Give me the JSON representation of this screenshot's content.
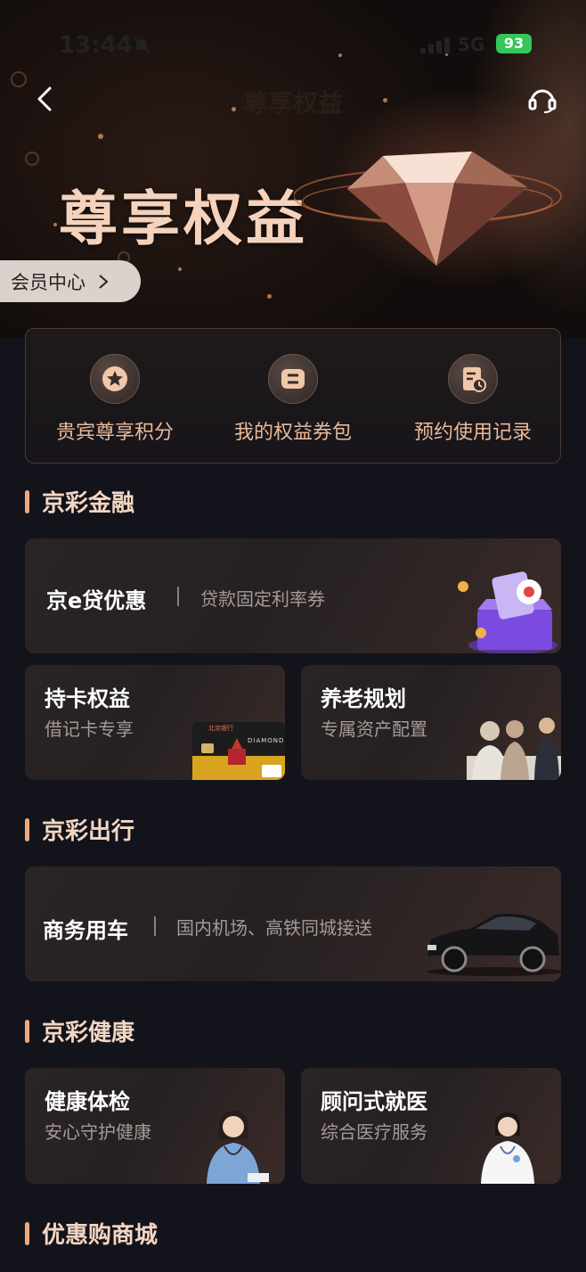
{
  "status": {
    "time": "13:44",
    "network": "5G",
    "battery": "93"
  },
  "nav": {
    "title": "尊享权益"
  },
  "hero": {
    "title": "尊享权益",
    "member_center": "会员中心"
  },
  "quick": [
    {
      "label": "贵宾尊享积分",
      "icon": "star-badge-icon"
    },
    {
      "label": "我的权益券包",
      "icon": "coupon-icon"
    },
    {
      "label": "预约使用记录",
      "icon": "record-icon"
    }
  ],
  "sections": {
    "finance": "京彩金融",
    "travel": "京彩出行",
    "health": "京彩健康",
    "mall": "优惠购商城"
  },
  "finance": {
    "loan": {
      "title": "京e贷优惠",
      "sub": "贷款固定利率券"
    },
    "card": {
      "title": "持卡权益",
      "sub": "借记卡专享",
      "card_text": "DIAMOND",
      "bank": "北京银行"
    },
    "pension": {
      "title": "养老规划",
      "sub": "专属资产配置"
    }
  },
  "travel": {
    "car": {
      "title": "商务用车",
      "sub": "国内机场、高铁同城接送"
    }
  },
  "health": {
    "checkup": {
      "title": "健康体检",
      "sub": "安心守护健康"
    },
    "advisor": {
      "title": "顾问式就医",
      "sub": "综合医疗服务"
    }
  },
  "colors": {
    "accent": "#f0a77c",
    "background": "#13131b",
    "battery": "#34c759"
  }
}
